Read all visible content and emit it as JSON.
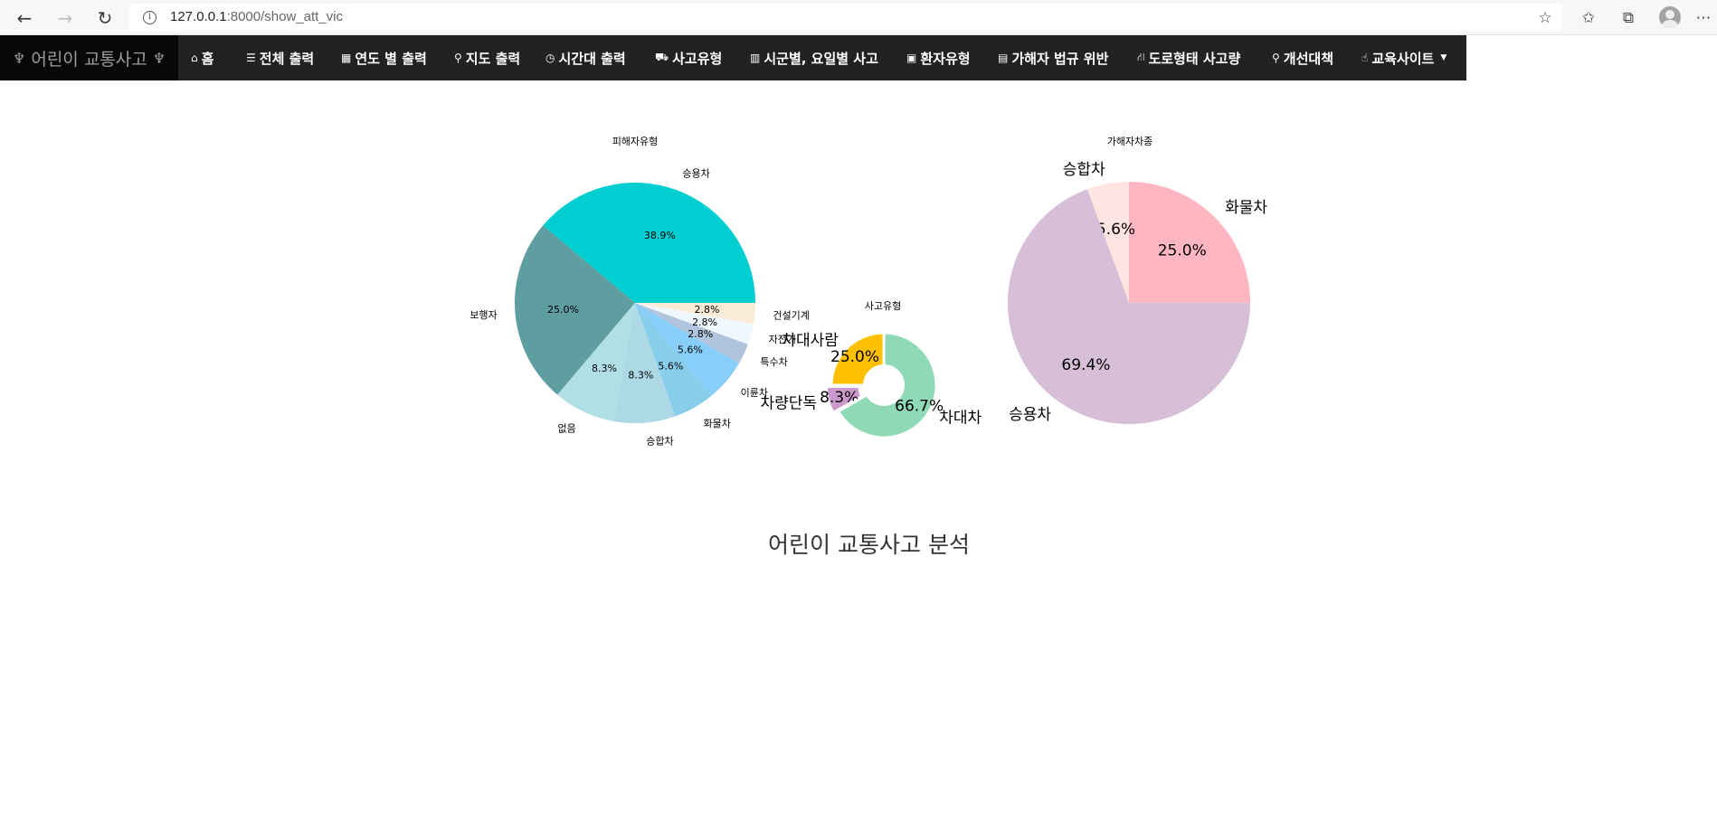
{
  "browser": {
    "url_host": "127.0.0.1",
    "url_path": ":8000/show_att_vic"
  },
  "navbar": {
    "brand": "어린이 교통사고",
    "items": [
      {
        "label": "홈",
        "icon": "home-icon",
        "glyph": "⌂"
      },
      {
        "label": "전체 출력",
        "icon": "database-icon",
        "glyph": "☰"
      },
      {
        "label": "연도 별 출력",
        "icon": "calendar-icon",
        "glyph": "▦"
      },
      {
        "label": "지도 출력",
        "icon": "map-marker-icon",
        "glyph": "⚲"
      },
      {
        "label": "시간대 출력",
        "icon": "clock-icon",
        "glyph": "◷"
      },
      {
        "label": "사고유형",
        "icon": "car-icon",
        "glyph": "⛟"
      },
      {
        "label": "시군별, 요일별 사고",
        "icon": "bar-chart-icon",
        "glyph": "▥"
      },
      {
        "label": "환자유형",
        "icon": "clipboard-icon",
        "glyph": "▣"
      },
      {
        "label": "가해자 법규 위반",
        "icon": "id-card-icon",
        "glyph": "▤"
      },
      {
        "label": "도로형태 사고량",
        "icon": "road-icon",
        "glyph": "⛙"
      },
      {
        "label": "개선대책",
        "icon": "lightbulb-icon",
        "glyph": "⚲"
      },
      {
        "label": "교육사이트",
        "icon": "thumbs-up-icon",
        "glyph": "☝"
      }
    ]
  },
  "chart_data": [
    {
      "type": "pie",
      "title": "피해자유형",
      "slices": [
        {
          "label": "승용차",
          "value": 38.9,
          "pct_label": "38.9%",
          "color": "#00CED1"
        },
        {
          "label": "보행자",
          "value": 25.0,
          "pct_label": "25.0%",
          "color": "#5F9EA0"
        },
        {
          "label": "없음",
          "value": 8.3,
          "pct_label": "8.3%",
          "color": "#B0E0E6"
        },
        {
          "label": "승합차",
          "value": 8.3,
          "pct_label": "8.3%",
          "color": "#ADD8E6"
        },
        {
          "label": "화물차",
          "value": 5.6,
          "pct_label": "5.6%",
          "color": "#87CEEB"
        },
        {
          "label": "이륜차",
          "value": 5.6,
          "pct_label": "5.6%",
          "color": "#87CEFA"
        },
        {
          "label": "특수차",
          "value": 2.8,
          "pct_label": "2.8%",
          "color": "#B0C4DE"
        },
        {
          "label": "자전거",
          "value": 2.8,
          "pct_label": "2.8%",
          "color": "#F0F8FF"
        },
        {
          "label": "건설기계",
          "value": 2.8,
          "pct_label": "2.8%",
          "color": "#FAEBD7"
        }
      ]
    },
    {
      "type": "pie",
      "title": "사고유형",
      "donut": true,
      "slices": [
        {
          "label": "차대사람",
          "value": 25.0,
          "pct_label": "25.0%",
          "color": "#FFC000"
        },
        {
          "label": "차량단독",
          "value": 8.3,
          "pct_label": "8.3%",
          "color": "#CC99CC"
        },
        {
          "label": "차대차",
          "value": 66.7,
          "pct_label": "66.7%",
          "color": "#8FD9B6"
        }
      ]
    },
    {
      "type": "pie",
      "title": "가해자차종",
      "slices": [
        {
          "label": "화물차",
          "value": 25.0,
          "pct_label": "25.0%",
          "color": "#FFB6C1"
        },
        {
          "label": "승합차",
          "value": 5.6,
          "pct_label": "5.6%",
          "color": "#FFE4E1"
        },
        {
          "label": "승용차",
          "value": 69.4,
          "pct_label": "69.4%",
          "color": "#D8BFD8"
        }
      ]
    }
  ],
  "page_title": "어린이 교통사고 분석"
}
